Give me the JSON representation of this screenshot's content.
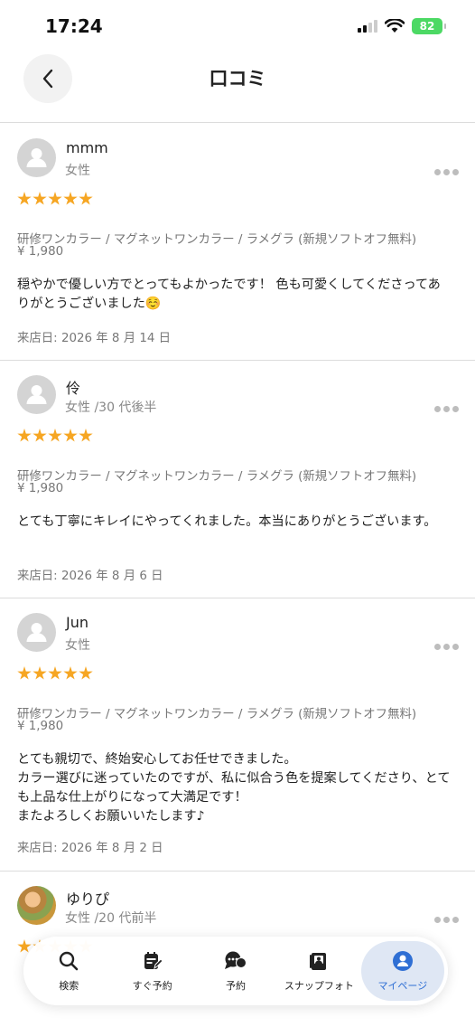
{
  "status_bar": {
    "time": "17:24",
    "battery": "82"
  },
  "header": {
    "title": "口コミ"
  },
  "reviews": [
    {
      "name": "mmm",
      "meta": "女性",
      "rating": 5,
      "menu": "研修ワンカラー / マグネットワンカラー / ラメグラ (新規ソフトオフ無料)",
      "price": "¥ 1,980",
      "comment": "穏やかで優しい方でとってもよかったです！ 色も可愛くしてくださってありがとうございました☺️",
      "visit_date": "来店日:  2026 年 8 月 14 日"
    },
    {
      "name": "伶",
      "meta": "女性 /30 代後半",
      "rating": 5,
      "menu": "研修ワンカラー / マグネットワンカラー / ラメグラ (新規ソフトオフ無料)",
      "price": "¥ 1,980",
      "comment": "とても丁寧にキレイにやってくれました。本当にありがとうございます。",
      "visit_date": "来店日:  2026 年 8 月 6 日"
    },
    {
      "name": "Jun",
      "meta": "女性",
      "rating": 5,
      "menu": "研修ワンカラー / マグネットワンカラー / ラメグラ (新規ソフトオフ無料)",
      "price": "¥ 1,980",
      "comment": "とても親切で、終始安心してお任せできました。\nカラー選びに迷っていたのですが、私に似合う色を提案してくださり、とても上品な仕上がりになって大満足です！\nまたよろしくお願いいたします♪",
      "visit_date": "来店日:  2026 年 8 月 2 日"
    },
    {
      "name": "ゆりぴ",
      "meta": "女性 /20 代前半"
    }
  ],
  "tab_bar": {
    "items": [
      {
        "label": "検索",
        "icon": "search-icon"
      },
      {
        "label": "すぐ予約",
        "icon": "calendar-edit-icon"
      },
      {
        "label": "予約",
        "icon": "chat-bubble-icon"
      },
      {
        "label": "スナップフォト",
        "icon": "photo-album-icon"
      },
      {
        "label": "マイページ",
        "icon": "person-icon"
      }
    ],
    "active_index": 4,
    "active_color": "#2f6fd4",
    "active_bg": "#dfe7f4"
  },
  "colors": {
    "star": "#f6a623",
    "divider": "#dcdcdc"
  }
}
